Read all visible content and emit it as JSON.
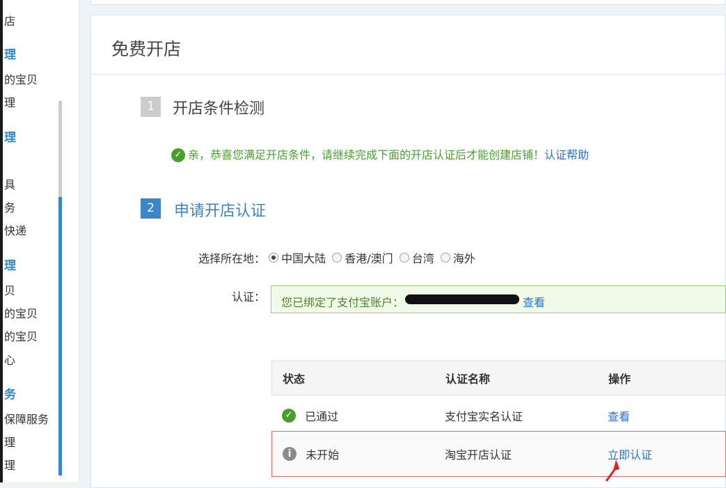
{
  "sidebar": {
    "items": [
      {
        "text": "店",
        "type": "item"
      },
      {
        "text": "理",
        "type": "head"
      },
      {
        "text": "的宝贝",
        "type": "item"
      },
      {
        "text": "理",
        "type": "item"
      },
      {
        "text": "理",
        "type": "head"
      },
      {
        "text": "具",
        "type": "item"
      },
      {
        "text": "务",
        "type": "item"
      },
      {
        "text": "快递",
        "type": "item"
      },
      {
        "text": "理",
        "type": "head"
      },
      {
        "text": "贝",
        "type": "item"
      },
      {
        "text": "的宝贝",
        "type": "item"
      },
      {
        "text": "的宝贝",
        "type": "item"
      },
      {
        "text": "心",
        "type": "item"
      },
      {
        "text": "务",
        "type": "head"
      },
      {
        "text": "保障服务",
        "type": "item"
      },
      {
        "text": "理",
        "type": "item"
      },
      {
        "text": "理",
        "type": "item"
      }
    ]
  },
  "page": {
    "title": "免费开店"
  },
  "steps": [
    {
      "num": "1",
      "title": "开店条件检测"
    },
    {
      "num": "2",
      "title": "申请开店认证"
    }
  ],
  "success": {
    "message": "亲，恭喜您满足开店条件，请继续完成下面的开店认证后才能创建店铺！",
    "help_link": "认证帮助"
  },
  "region": {
    "label": "选择所在地：",
    "options": [
      "中国大陆",
      "香港/澳门",
      "台湾",
      "海外"
    ],
    "selected": "中国大陆"
  },
  "auth": {
    "label": "认证：",
    "message": "您已绑定了支付宝账户：",
    "link": "查看"
  },
  "table": {
    "headers": [
      "状态",
      "认证名称",
      "操作"
    ],
    "rows": [
      {
        "status": "已通过",
        "name": "支付宝实名认证",
        "action": "查看",
        "icon": "check-icon"
      },
      {
        "status": "未开始",
        "name": "淘宝开店认证",
        "action": "立即认证",
        "icon": "info-icon"
      }
    ]
  },
  "colors": {
    "accent": "#3d86c6",
    "success": "#4a9f2c",
    "link": "#2f72c2",
    "highlight_border": "#e86a6a"
  }
}
